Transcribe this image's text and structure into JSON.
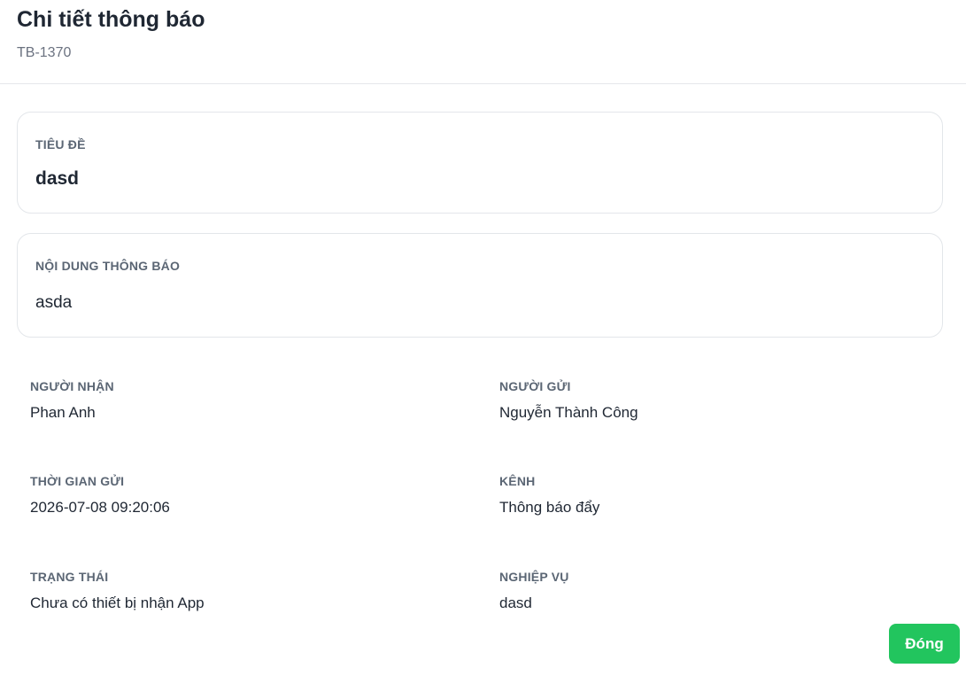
{
  "header": {
    "title": "Chi tiết thông báo",
    "code": "TB-1370"
  },
  "title_card": {
    "label": "TIÊU ĐỀ",
    "value": "dasd"
  },
  "content_card": {
    "label": "NỘI DUNG THÔNG BÁO",
    "value": "asda"
  },
  "fields": {
    "recipient": {
      "label": "NGƯỜI NHẬN",
      "value": "Phan Anh"
    },
    "sender": {
      "label": "NGƯỜI GỬI",
      "value": "Nguyễn Thành Công"
    },
    "sent_time": {
      "label": "THỜI GIAN GỬI",
      "value": "2026-07-08 09:20:06"
    },
    "channel": {
      "label": "KÊNH",
      "value": "Thông báo đẩy"
    },
    "status": {
      "label": "TRẠNG THÁI",
      "value": "Chưa có thiết bị nhận App"
    },
    "business": {
      "label": "NGHIỆP VỤ",
      "value": "dasd"
    }
  },
  "footer": {
    "close_label": "Đóng"
  },
  "colors": {
    "accent": "#22c55e",
    "label": "#5b6674",
    "text": "#1f2733",
    "border": "#e3e6ea"
  }
}
